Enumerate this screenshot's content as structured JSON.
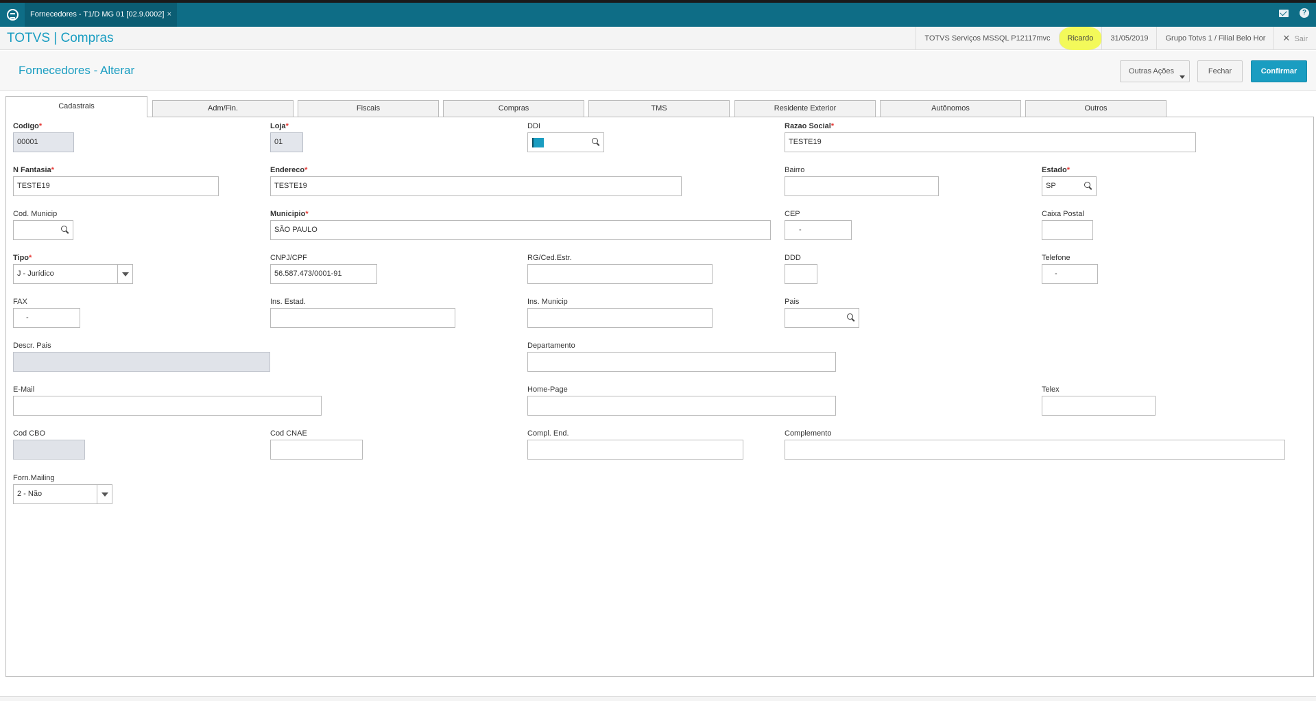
{
  "window": {
    "tab_title": "Fornecedores - T1/D MG 01  [02.9.0002]",
    "close_glyph": "×"
  },
  "appbar": {
    "app_name": "TOTVS | Compras",
    "server": "TOTVS Serviços MSSQL P12117mvc",
    "user": "Ricardo",
    "date": "31/05/2019",
    "branch": "Grupo Totvs 1 / Filial Belo Hor",
    "exit_label": "Sair",
    "exit_icon": "close-icon"
  },
  "header": {
    "title": "Fornecedores - Alterar",
    "other_actions": "Outras Ações",
    "close": "Fechar",
    "confirm": "Confirmar"
  },
  "tabs": [
    "Cadastrais",
    "Adm/Fin.",
    "Fiscais",
    "Compras",
    "TMS",
    "Residente Exterior",
    "Autônomos",
    "Outros"
  ],
  "active_tab": "Cadastrais",
  "fields": {
    "codigo": {
      "label": "Codigo",
      "required": "*",
      "value": "00001"
    },
    "loja": {
      "label": "Loja",
      "required": "*",
      "value": "01"
    },
    "ddi": {
      "label": "DDI",
      "value": ""
    },
    "razao_social": {
      "label": "Razao Social",
      "required": "*",
      "value": "TESTE19"
    },
    "n_fantasia": {
      "label": "N Fantasia",
      "required": "*",
      "value": "TESTE19"
    },
    "endereco": {
      "label": "Endereco",
      "required": "*",
      "value": "TESTE19"
    },
    "bairro": {
      "label": "Bairro",
      "value": ""
    },
    "estado": {
      "label": "Estado",
      "required": "*",
      "value": "SP"
    },
    "cod_municip": {
      "label": "Cod. Municip",
      "value": ""
    },
    "municipio": {
      "label": "Municipio",
      "required": "*",
      "value": "SÃO PAULO"
    },
    "cep": {
      "label": "CEP",
      "value": "-"
    },
    "caixa_postal": {
      "label": "Caixa Postal",
      "value": ""
    },
    "tipo": {
      "label": "Tipo",
      "required": "*",
      "value": "J - Jurídico"
    },
    "cnpj_cpf": {
      "label": "CNPJ/CPF",
      "value": "56.587.473/0001-91"
    },
    "rg_ced_estr": {
      "label": "RG/Ced.Estr.",
      "value": ""
    },
    "ddd": {
      "label": "DDD",
      "value": ""
    },
    "telefone": {
      "label": "Telefone",
      "value": "-"
    },
    "fax": {
      "label": "FAX",
      "value": "-"
    },
    "ins_estad": {
      "label": "Ins. Estad.",
      "value": ""
    },
    "ins_municip": {
      "label": "Ins. Municip",
      "value": ""
    },
    "pais": {
      "label": "Pais",
      "value": ""
    },
    "descr_pais": {
      "label": "Descr. Pais",
      "value": ""
    },
    "departamento": {
      "label": "Departamento",
      "value": ""
    },
    "email": {
      "label": "E-Mail",
      "value": ""
    },
    "home_page": {
      "label": "Home-Page",
      "value": ""
    },
    "telex": {
      "label": "Telex",
      "value": ""
    },
    "cod_cbo": {
      "label": "Cod CBO",
      "value": ""
    },
    "cod_cnae": {
      "label": "Cod CNAE",
      "value": ""
    },
    "compl_end": {
      "label": "Compl. End.",
      "value": ""
    },
    "complemento": {
      "label": "Complemento",
      "value": ""
    },
    "forn_mailing": {
      "label": "Forn.Mailing",
      "value": "2 - Não"
    }
  },
  "colors": {
    "titlebar": "#0e6d86",
    "accent": "#1a9dc1",
    "highlight": "#f3f95a",
    "required": "#e53935"
  }
}
